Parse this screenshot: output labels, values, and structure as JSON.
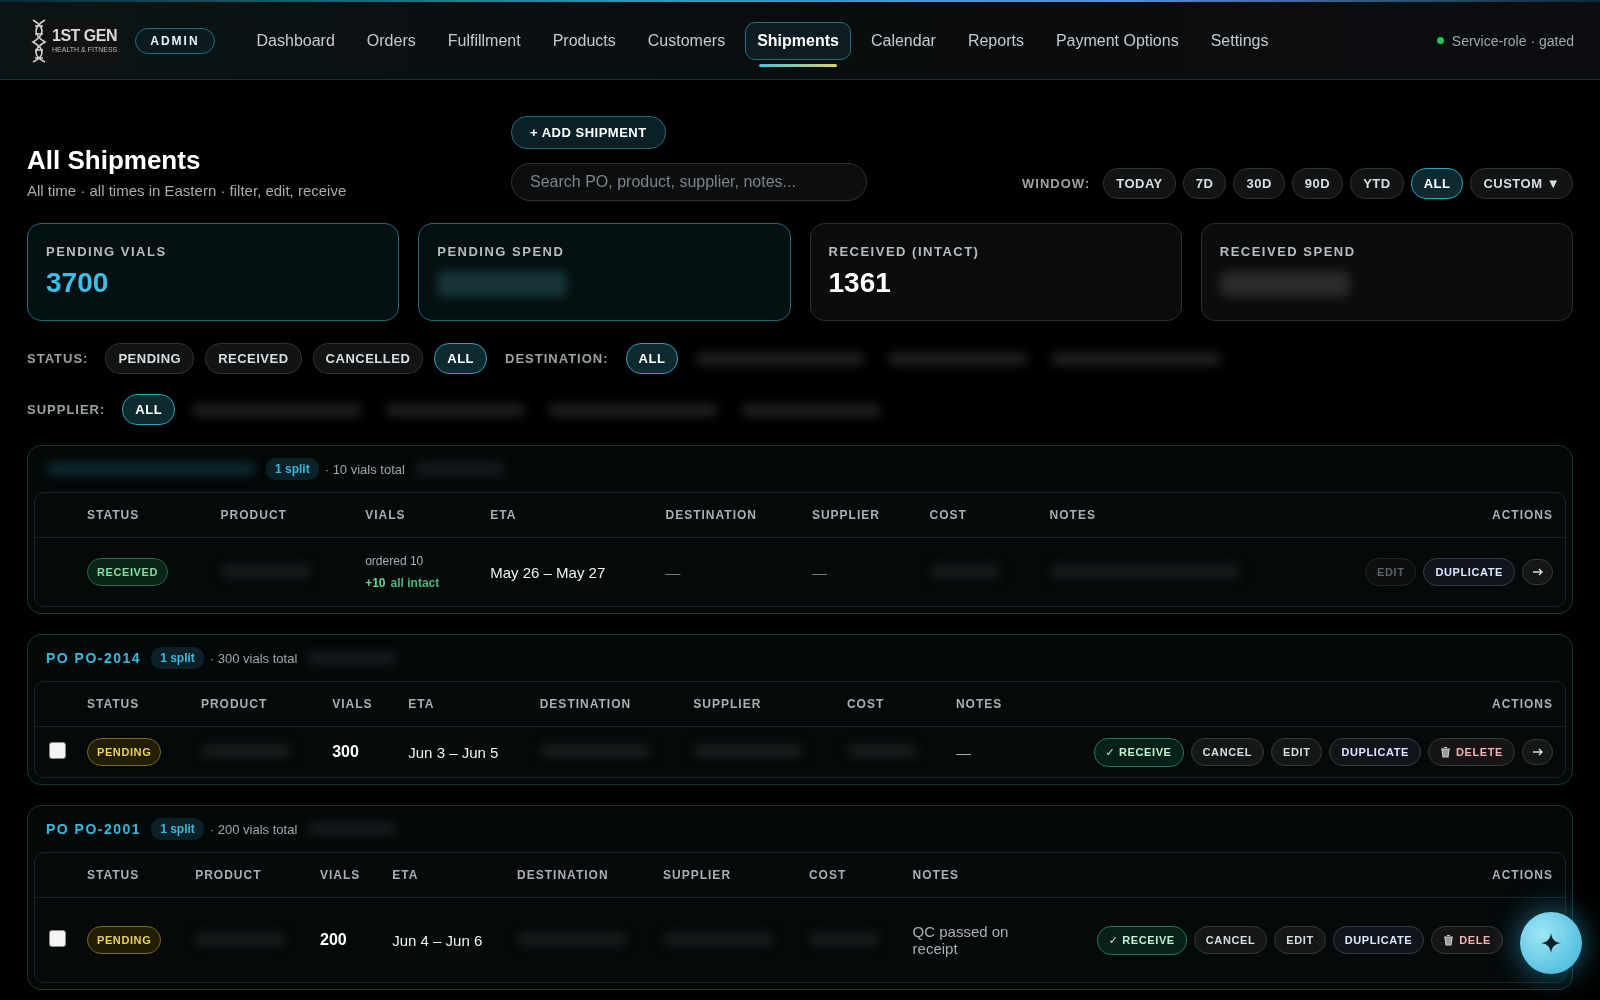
{
  "header": {
    "logo": {
      "title": "1ST GEN",
      "subtitle": "HEALTH & FITNESS"
    },
    "role_badge": "ADMIN",
    "nav": [
      {
        "label": "Dashboard",
        "selected": false
      },
      {
        "label": "Orders",
        "selected": false
      },
      {
        "label": "Fulfillment",
        "selected": false
      },
      {
        "label": "Products",
        "selected": false
      },
      {
        "label": "Customers",
        "selected": false
      },
      {
        "label": "Shipments",
        "selected": true
      },
      {
        "label": "Calendar",
        "selected": false
      },
      {
        "label": "Reports",
        "selected": false
      },
      {
        "label": "Payment Options",
        "selected": false
      },
      {
        "label": "Settings",
        "selected": false
      }
    ],
    "service_status": {
      "label": "Service-role · gated",
      "color": "#22c55e"
    }
  },
  "page": {
    "title": "All Shipments",
    "subtitle": "All time · all times in Eastern · filter, edit, receive",
    "add_button": "+ ADD SHIPMENT",
    "search": {
      "placeholder": "Search PO, product, supplier, notes..."
    },
    "window": {
      "label": "WINDOW:",
      "options": [
        {
          "label": "TODAY",
          "selected": false
        },
        {
          "label": "7D",
          "selected": false
        },
        {
          "label": "30D",
          "selected": false
        },
        {
          "label": "90D",
          "selected": false
        },
        {
          "label": "YTD",
          "selected": false
        },
        {
          "label": "ALL",
          "selected": true
        },
        {
          "label": "CUSTOM ▼",
          "selected": false
        }
      ]
    }
  },
  "kpis": [
    {
      "label": "PENDING VIALS",
      "value": "3700",
      "highlighted": true
    },
    {
      "label": "PENDING SPEND",
      "highlighted": true
    },
    {
      "label": "RECEIVED (INTACT)",
      "value": "1361",
      "highlighted": false
    },
    {
      "label": "RECEIVED SPEND",
      "highlighted": false
    }
  ],
  "filters": [
    {
      "label": "STATUS:",
      "options": [
        {
          "label": "PENDING",
          "selected": false,
          "redacted": false
        },
        {
          "label": "RECEIVED",
          "selected": false,
          "redacted": false
        },
        {
          "label": "CANCELLED",
          "selected": false,
          "redacted": false
        },
        {
          "label": "ALL",
          "selected": true,
          "redacted": false
        }
      ]
    },
    {
      "label": "DESTINATION:",
      "options": [
        {
          "label": "ALL",
          "selected": true,
          "redacted": false
        },
        {
          "redacted": true
        },
        {
          "redacted": true
        },
        {
          "redacted": true
        }
      ]
    },
    {
      "label": "SUPPLIER:",
      "options": [
        {
          "label": "ALL",
          "selected": true,
          "redacted": false
        },
        {
          "redacted": true
        },
        {
          "redacted": true
        },
        {
          "redacted": true
        },
        {
          "redacted": true
        }
      ]
    }
  ],
  "shipments": [
    {
      "split_badge": "1 split",
      "total": "· 10 vials total",
      "columns": [
        "STATUS",
        "PRODUCT",
        "VIALS",
        "ETA",
        "DESTINATION",
        "SUPPLIER",
        "COST",
        "NOTES",
        "ACTIONS"
      ],
      "rows": [
        {
          "selectable": false,
          "status": {
            "label": "RECEIVED",
            "kind": "received"
          },
          "vials": {
            "ordered": "ordered 10",
            "received": "+10",
            "condition": "all intact"
          },
          "eta": "May 26 – May 27",
          "destination": "—",
          "supplier": "—",
          "actions": [
            {
              "kind": "edit",
              "label": "EDIT",
              "disabled": true
            },
            {
              "kind": "duplicate",
              "label": "DUPLICATE",
              "disabled": false
            },
            {
              "kind": "open",
              "disabled": false
            }
          ]
        }
      ]
    },
    {
      "title": "PO PO-2014",
      "split_badge": "1 split",
      "total": "· 300 vials total",
      "columns": [
        "STATUS",
        "PRODUCT",
        "VIALS",
        "ETA",
        "DESTINATION",
        "SUPPLIER",
        "COST",
        "NOTES",
        "ACTIONS"
      ],
      "rows": [
        {
          "selectable": true,
          "checked": false,
          "status": {
            "label": "PENDING",
            "kind": "pending"
          },
          "vials": {
            "count": "300"
          },
          "eta": "Jun 3 – Jun 5",
          "notes": "—",
          "actions": [
            {
              "kind": "receive",
              "label": "✓ RECEIVE",
              "disabled": false
            },
            {
              "kind": "cancel",
              "label": "CANCEL",
              "disabled": false
            },
            {
              "kind": "edit",
              "label": "EDIT",
              "disabled": false
            },
            {
              "kind": "duplicate",
              "label": "DUPLICATE",
              "disabled": false
            },
            {
              "kind": "delete",
              "label": "DELETE",
              "disabled": false
            },
            {
              "kind": "open",
              "disabled": false
            }
          ]
        }
      ]
    },
    {
      "title": "PO PO-2001",
      "split_badge": "1 split",
      "total": "· 200 vials total",
      "columns": [
        "STATUS",
        "PRODUCT",
        "VIALS",
        "ETA",
        "DESTINATION",
        "SUPPLIER",
        "COST",
        "NOTES",
        "ACTIONS"
      ],
      "rows": [
        {
          "selectable": true,
          "checked": false,
          "status": {
            "label": "PENDING",
            "kind": "pending"
          },
          "vials": {
            "count": "200"
          },
          "eta": "Jun 4 – Jun 6",
          "notes": "QC passed on receipt",
          "actions": [
            {
              "kind": "receive",
              "label": "✓ RECEIVE",
              "disabled": false
            },
            {
              "kind": "cancel",
              "label": "CANCEL",
              "disabled": false
            },
            {
              "kind": "edit",
              "label": "EDIT",
              "disabled": false
            },
            {
              "kind": "duplicate",
              "label": "DUPLICATE",
              "disabled": false
            },
            {
              "kind": "delete",
              "label": "DELE",
              "disabled": false
            }
          ]
        }
      ]
    }
  ]
}
